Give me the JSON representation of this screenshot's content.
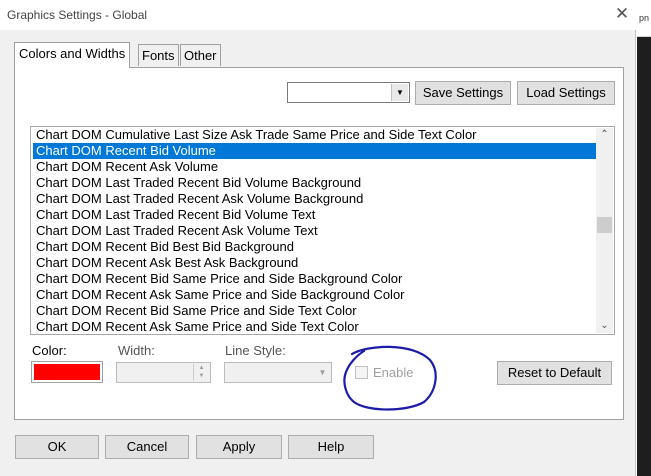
{
  "window": {
    "title": "Graphics Settings - Global",
    "close_glyph": "✕",
    "edge_text": "pn"
  },
  "tabs": [
    {
      "label": "Colors and Widths",
      "active": true
    },
    {
      "label": "Fonts",
      "active": false
    },
    {
      "label": "Other",
      "active": false
    }
  ],
  "toolbar": {
    "combo_value": "",
    "combo_arrow": "▼",
    "save_label": "Save Settings",
    "load_label": "Load Settings"
  },
  "list": {
    "items": [
      "Chart DOM Cumulative Last Size Ask Trade Same Price and Side Text Color",
      "Chart DOM Recent Bid Volume",
      "Chart DOM Recent Ask Volume",
      "Chart DOM Last Traded Recent Bid Volume Background",
      "Chart DOM Last Traded Recent Ask Volume Background",
      "Chart DOM Last Traded Recent Bid Volume Text",
      "Chart DOM Last Traded Recent Ask Volume Text",
      "Chart DOM Recent Bid Best Bid Background",
      "Chart DOM Recent Ask Best Ask Background",
      "Chart DOM Recent Bid Same Price and Side Background Color",
      "Chart DOM Recent Ask Same Price and Side Background Color",
      "Chart DOM Recent Bid Same Price and Side Text Color",
      "Chart DOM Recent Ask Same Price and Side Text Color"
    ],
    "selected_index": 1,
    "scroll_up": "⌃",
    "scroll_down": "⌄"
  },
  "properties": {
    "color_label": "Color:",
    "color_value": "#ff0000",
    "width_label": "Width:",
    "width_value": "",
    "line_style_label": "Line Style:",
    "line_style_value": "",
    "enable_label": "Enable",
    "enable_checked": false,
    "reset_label": "Reset to Default"
  },
  "annotation": {
    "color": "#1c1ca8"
  },
  "footer": {
    "ok_label": "OK",
    "cancel_label": "Cancel",
    "apply_label": "Apply",
    "help_label": "Help"
  },
  "colors": {
    "selection": "#0078d7",
    "dialog_bg": "#f0f0f0"
  }
}
